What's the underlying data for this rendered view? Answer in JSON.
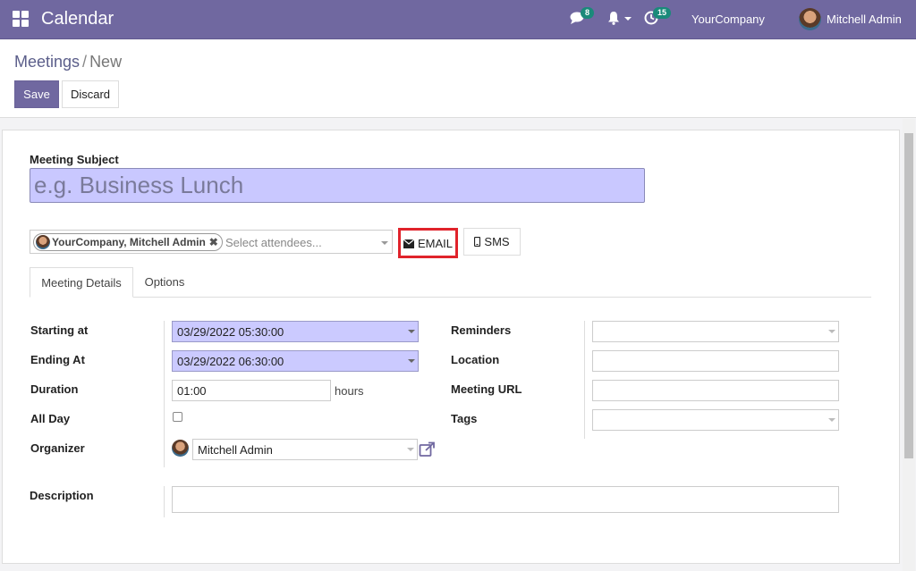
{
  "app": {
    "title": "Calendar"
  },
  "nav": {
    "messages_count": "8",
    "activities_count": "15",
    "company": "YourCompany",
    "user": "Mitchell Admin"
  },
  "breadcrumb": {
    "parent": "Meetings",
    "separator": "/",
    "current": "New"
  },
  "toolbar": {
    "save_label": "Save",
    "discard_label": "Discard"
  },
  "form": {
    "subject_label": "Meeting Subject",
    "subject_placeholder": "e.g. Business Lunch",
    "attendee_tag": "YourCompany, Mitchell Admin",
    "attendee_remove": "✖",
    "attendees_placeholder": "Select attendees...",
    "email_label": "EMAIL",
    "sms_label": "SMS"
  },
  "tabs": [
    {
      "label": "Meeting Details",
      "active": true
    },
    {
      "label": "Options",
      "active": false
    }
  ],
  "details": {
    "starting_at_label": "Starting at",
    "starting_at_value": "03/29/2022 05:30:00",
    "ending_at_label": "Ending At",
    "ending_at_value": "03/29/2022 06:30:00",
    "duration_label": "Duration",
    "duration_value": "01:00",
    "duration_unit": "hours",
    "all_day_label": "All Day",
    "organizer_label": "Organizer",
    "organizer_value": "Mitchell Admin",
    "reminders_label": "Reminders",
    "location_label": "Location",
    "meeting_url_label": "Meeting URL",
    "tags_label": "Tags",
    "description_label": "Description"
  },
  "colors": {
    "brand": "#7068a0",
    "date_field_bg": "#cbcaff",
    "highlight_border": "#e0232b",
    "badge": "#1a8a7a"
  }
}
